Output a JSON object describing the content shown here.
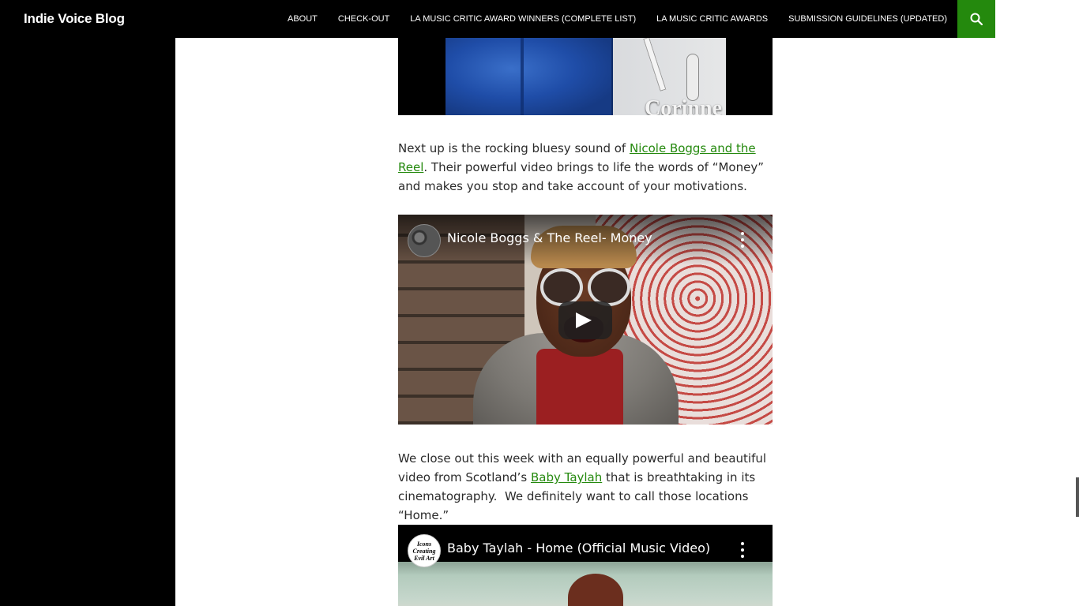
{
  "header": {
    "site_title": "Indie Voice Blog",
    "nav": [
      {
        "label": "ABOUT"
      },
      {
        "label": "CHECK-OUT"
      },
      {
        "label": "LA MUSIC CRITIC AWARD WINNERS (COMPLETE LIST)"
      },
      {
        "label": "LA MUSIC CRITIC AWARDS"
      },
      {
        "label": "SUBMISSION GUIDELINES (UPDATED)"
      }
    ],
    "search_icon": "search-icon",
    "accent_color": "#24890d"
  },
  "hero_image": {
    "caption": "Corinne"
  },
  "paragraph1": {
    "before": "Next up is the rocking bluesy sound of ",
    "link": "Nicole Boggs and the Reel",
    "after": ". Their powerful video brings to life the words of “Money” and makes you stop and take account of your motivations."
  },
  "video1": {
    "title": "Nicole Boggs & The Reel- Money",
    "play_icon": "play-icon",
    "menu_icon": "more-vert-icon"
  },
  "paragraph2": {
    "before": "We close out this week with an equally powerful and beautiful video from Scotland’s ",
    "link": "Baby Taylah",
    "after": " that is breathtaking in its cinematography.  We definitely want to call those locations “Home.”"
  },
  "video2": {
    "title": "Baby Taylah - Home (Official Music Video)",
    "channel_logo_text": "Icons Creating Evil Art",
    "menu_icon": "more-vert-icon"
  }
}
